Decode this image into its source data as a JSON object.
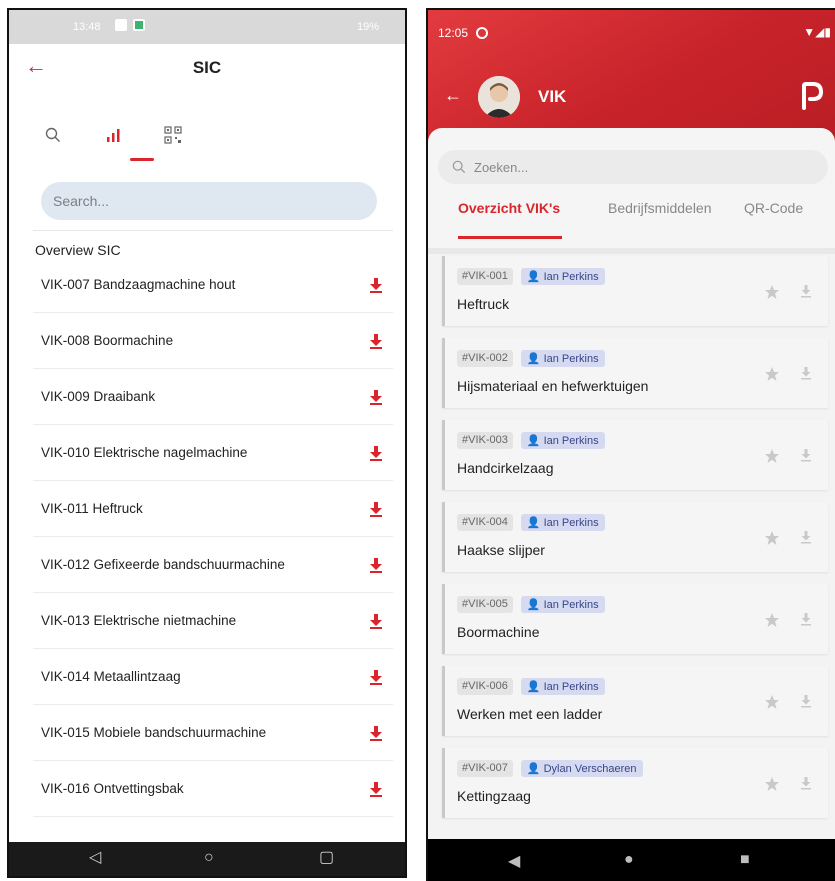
{
  "left": {
    "status": {
      "time": "13:48",
      "right_text": "19%"
    },
    "header": {
      "title": "SIC"
    },
    "tabs": [
      {
        "name": "search-tab",
        "icon": "search-icon"
      },
      {
        "name": "overview-tab",
        "icon": "bar-chart-icon"
      },
      {
        "name": "qr-tab",
        "icon": "qr-code-icon"
      }
    ],
    "search": {
      "placeholder": "Search..."
    },
    "section_title": "Overview SIC",
    "items": [
      "VIK-007 Bandzaagmachine hout",
      "VIK-008 Boormachine",
      "VIK-009 Draaibank",
      "VIK-010 Elektrische nagelmachine",
      "VIK-011 Heftruck",
      "VIK-012 Gefixeerde bandschuurmachine",
      "VIK-013 Elektrische nietmachine",
      "VIK-014 Metaallintzaag",
      "VIK-015 Mobiele bandschuurmachine",
      "VIK-016 Ontvettingsbak"
    ],
    "accent": "#d9262c"
  },
  "right": {
    "status": {
      "time": "12:05"
    },
    "header": {
      "title": "VIK"
    },
    "search": {
      "placeholder": "Zoeken..."
    },
    "tabs": [
      "Overzicht VIK's",
      "Bedrijfsmiddelen",
      "QR-Code"
    ],
    "items": [
      {
        "code": "#VIK-001",
        "user": "Ian Perkins",
        "name": "Heftruck"
      },
      {
        "code": "#VIK-002",
        "user": "Ian Perkins",
        "name": "Hijsmateriaal en hefwerktuigen"
      },
      {
        "code": "#VIK-003",
        "user": "Ian Perkins",
        "name": "Handcirkelzaag"
      },
      {
        "code": "#VIK-004",
        "user": "Ian Perkins",
        "name": "Haakse slijper"
      },
      {
        "code": "#VIK-005",
        "user": "Ian Perkins",
        "name": "Boormachine"
      },
      {
        "code": "#VIK-006",
        "user": "Ian Perkins",
        "name": "Werken met een ladder"
      },
      {
        "code": "#VIK-007",
        "user": "Dylan Verschaeren",
        "name": "Kettingzaag"
      }
    ],
    "accent": "#d9262c"
  }
}
